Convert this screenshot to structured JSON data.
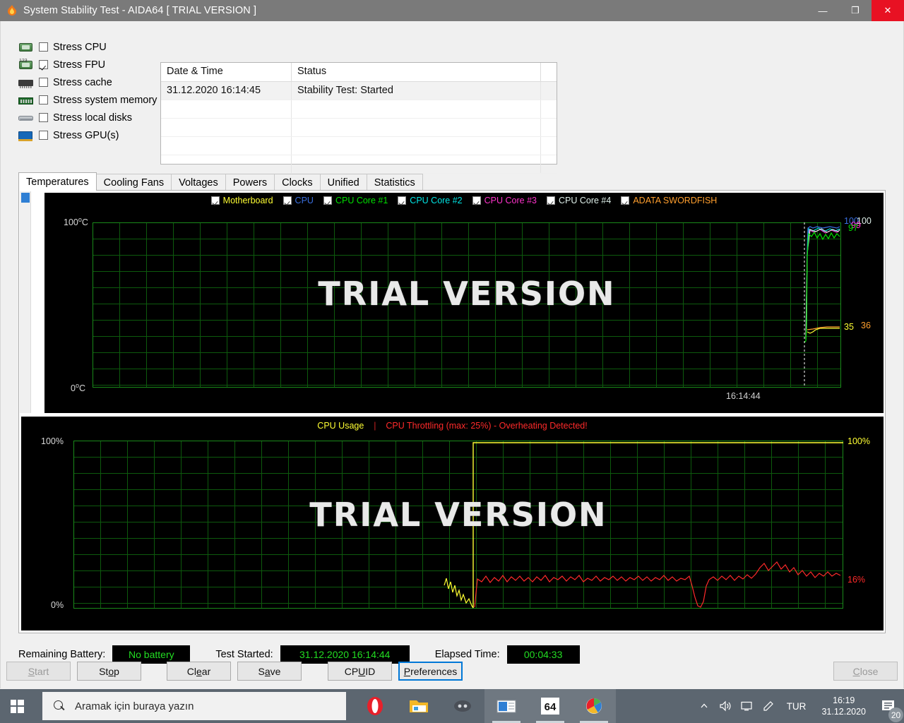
{
  "window": {
    "title": "System Stability Test - AIDA64  [ TRIAL VERSION ]",
    "icon": "flame-icon",
    "minimize": "—",
    "maximize": "❐",
    "close": "✕"
  },
  "stress_options": [
    {
      "label": "Stress CPU",
      "checked": false,
      "icon": "cpu-chip-icon"
    },
    {
      "label": "Stress FPU",
      "checked": true,
      "icon": "fpu-chip-icon"
    },
    {
      "label": "Stress cache",
      "checked": false,
      "icon": "cache-chip-icon"
    },
    {
      "label": "Stress system memory",
      "checked": false,
      "icon": "memory-module-icon"
    },
    {
      "label": "Stress local disks",
      "checked": false,
      "icon": "hard-disk-icon"
    },
    {
      "label": "Stress GPU(s)",
      "checked": false,
      "icon": "gpu-card-icon"
    }
  ],
  "log": {
    "columns": [
      "Date & Time",
      "Status",
      ""
    ],
    "rows": [
      {
        "datetime": "31.12.2020 16:14:45",
        "status": "Stability Test: Started",
        "extra": ""
      },
      {
        "datetime": "",
        "status": "",
        "extra": ""
      },
      {
        "datetime": "",
        "status": "",
        "extra": ""
      },
      {
        "datetime": "",
        "status": "",
        "extra": ""
      },
      {
        "datetime": "",
        "status": "",
        "extra": ""
      }
    ]
  },
  "tabs": [
    {
      "label": "Temperatures",
      "active": true
    },
    {
      "label": "Cooling Fans",
      "active": false
    },
    {
      "label": "Voltages",
      "active": false
    },
    {
      "label": "Powers",
      "active": false
    },
    {
      "label": "Clocks",
      "active": false
    },
    {
      "label": "Unified",
      "active": false
    },
    {
      "label": "Statistics",
      "active": false
    }
  ],
  "chart_data": [
    {
      "id": "temperatures",
      "type": "line",
      "title": "",
      "watermark": "TRIAL VERSION",
      "ylabel": "",
      "y_axis_top_label": "100",
      "y_axis_top_unit": "°C",
      "y_axis_bottom_label": "0",
      "y_axis_bottom_unit": "°C",
      "ylim": [
        0,
        100
      ],
      "grid": true,
      "legend_position": "top-center",
      "x_cursor_time": "16:14:44",
      "series": [
        {
          "name": "Motherboard",
          "color": "#ffff33",
          "checked": true,
          "current": "35",
          "label_right": "35"
        },
        {
          "name": "CPU",
          "color": "#3a6fe0",
          "checked": true,
          "current": "100",
          "label_right": "100"
        },
        {
          "name": "CPU Core #1",
          "color": "#00e000",
          "checked": true,
          "current": "97",
          "label_right": "97"
        },
        {
          "name": "CPU Core #2",
          "color": "#00e5e5",
          "checked": true,
          "current": "100",
          "label_right": "100"
        },
        {
          "name": "CPU Core #3",
          "color": "#ff33cc",
          "checked": true,
          "current": "99",
          "label_right": "99"
        },
        {
          "name": "CPU Core #4",
          "color": "#dff0ea",
          "checked": true,
          "current": "100",
          "label_right": "100"
        },
        {
          "name": "ADATA SWORDFISH",
          "color": "#ff9f2e",
          "checked": true,
          "current": "36",
          "label_right": "36"
        }
      ],
      "notes": "Temperatures flat at baseline then sharp rise to ~100C at the right edge; motherboard/disk flat near 35-36C."
    },
    {
      "id": "cpu_usage",
      "type": "line",
      "header_primary": "CPU Usage",
      "header_separator": "|",
      "header_warning": "CPU Throttling (max: 25%) - Overheating Detected!",
      "watermark": "TRIAL VERSION",
      "ylim": [
        0,
        100
      ],
      "y_axis_top_label": "100%",
      "y_axis_bottom_label": "0%",
      "y_right_top_label": "100%",
      "y_right_current_label": "16%",
      "grid": true,
      "series": [
        {
          "name": "CPU Usage",
          "color": "#ffff33",
          "current": "100",
          "unit": "%"
        },
        {
          "name": "CPU Throttling",
          "color": "#ff2a2a",
          "current": "16",
          "unit": "%"
        }
      ],
      "notes": "Yellow CPU Usage flat at 0% then steps to 100% at ~52% of the span and stays pinned; red throttling trace hovers around 15-25%."
    }
  ],
  "status": {
    "battery_label": "Remaining Battery:",
    "battery_value": "No battery",
    "started_label": "Test Started:",
    "started_value": "31.12.2020 16:14:44",
    "elapsed_label": "Elapsed Time:",
    "elapsed_value": "00:04:33"
  },
  "buttons": [
    {
      "name": "start",
      "pre": "",
      "accel": "S",
      "post": "tart",
      "disabled": true,
      "focused": false
    },
    {
      "name": "stop",
      "pre": "St",
      "accel": "o",
      "post": "p",
      "disabled": false,
      "focused": false
    },
    {
      "name": "clear",
      "pre": "Cl",
      "accel": "e",
      "post": "ar",
      "disabled": false,
      "focused": false
    },
    {
      "name": "save",
      "pre": "S",
      "accel": "a",
      "post": "ve",
      "disabled": false,
      "focused": false
    },
    {
      "name": "cpuid",
      "pre": "CP",
      "accel": "U",
      "post": "ID",
      "disabled": false,
      "focused": false
    },
    {
      "name": "preferences",
      "pre": "",
      "accel": "P",
      "post": "references",
      "disabled": false,
      "focused": true
    },
    {
      "name": "close",
      "pre": "",
      "accel": "C",
      "post": "lose",
      "disabled": true,
      "focused": false
    }
  ],
  "taskbar": {
    "start_icon": "windows-logo-icon",
    "search_placeholder": "Aramak için buraya yazın",
    "search_icon": "search-icon",
    "apps": [
      {
        "name": "opera-icon",
        "glyph": "O",
        "color": "#e8202a",
        "active": false
      },
      {
        "name": "file-explorer-icon",
        "glyph": "🗀",
        "color": "#f3b828",
        "active": false
      },
      {
        "name": "discord-icon",
        "glyph": "◕",
        "color": "#7289da",
        "active": false
      },
      {
        "name": "mail-icon",
        "glyph": "✉",
        "color": "#2f7fd4",
        "active": true
      },
      {
        "name": "aida64-icon",
        "glyph": "64",
        "color": "#ffffff",
        "active": true
      },
      {
        "name": "media-player-icon",
        "glyph": "▣",
        "color": "#4caf50",
        "active": true
      }
    ],
    "tray": {
      "chevron": "⌃",
      "volume_icon": "speaker-icon",
      "display_icon": "monitor-icon",
      "pen_icon": "pen-icon",
      "language": "TUR",
      "time": "16:19",
      "date": "31.12.2020",
      "action_center_icon": "notification-icon",
      "notification_count": "20"
    }
  }
}
